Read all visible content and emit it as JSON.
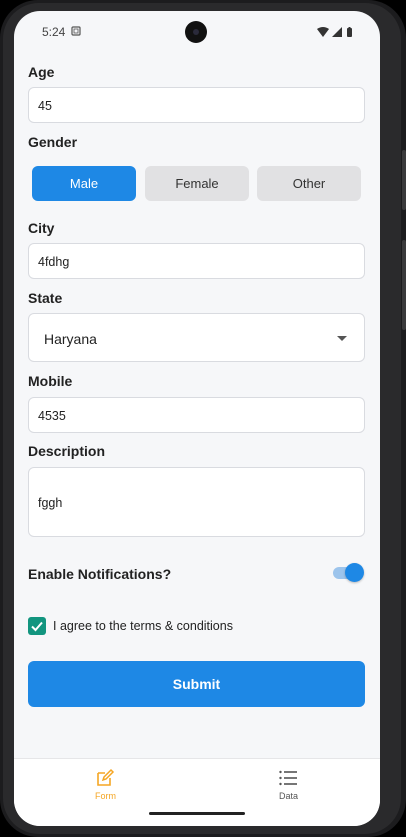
{
  "status_bar": {
    "time": "5:24"
  },
  "form": {
    "age": {
      "label": "Age",
      "value": "45"
    },
    "gender": {
      "label": "Gender",
      "options": [
        "Male",
        "Female",
        "Other"
      ],
      "selected": "Male"
    },
    "city": {
      "label": "City",
      "value": "4fdhg"
    },
    "state": {
      "label": "State",
      "value": "Haryana"
    },
    "mobile": {
      "label": "Mobile",
      "value": "4535"
    },
    "description": {
      "label": "Description",
      "value": "fggh"
    },
    "notifications": {
      "label": "Enable Notifications?",
      "enabled": true
    },
    "terms": {
      "label": "I agree to the terms & conditions",
      "checked": true
    },
    "submit_label": "Submit"
  },
  "bottom_nav": {
    "items": [
      {
        "label": "Form",
        "icon": "edit-icon",
        "active": true
      },
      {
        "label": "Data",
        "icon": "list-icon",
        "active": false
      }
    ]
  },
  "colors": {
    "accent": "#1e88e5",
    "active_nav": "#f5a623",
    "checkbox": "#12957f",
    "background": "#f6f7f9"
  }
}
